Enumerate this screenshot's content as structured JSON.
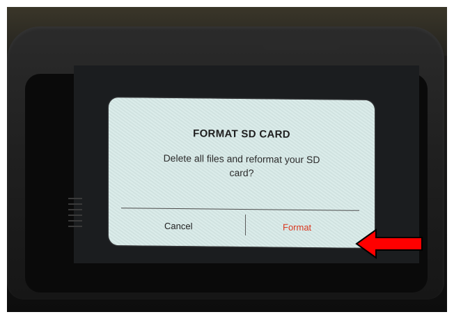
{
  "dialog": {
    "title": "FORMAT SD CARD",
    "message": "Delete all files and reformat your SD card?",
    "cancel_label": "Cancel",
    "format_label": "Format"
  },
  "colors": {
    "dialog_background": "#d9ebe9",
    "format_accent": "#d9371f",
    "arrow": "#ff0000"
  },
  "annotation": {
    "icon": "arrow-left-icon"
  }
}
